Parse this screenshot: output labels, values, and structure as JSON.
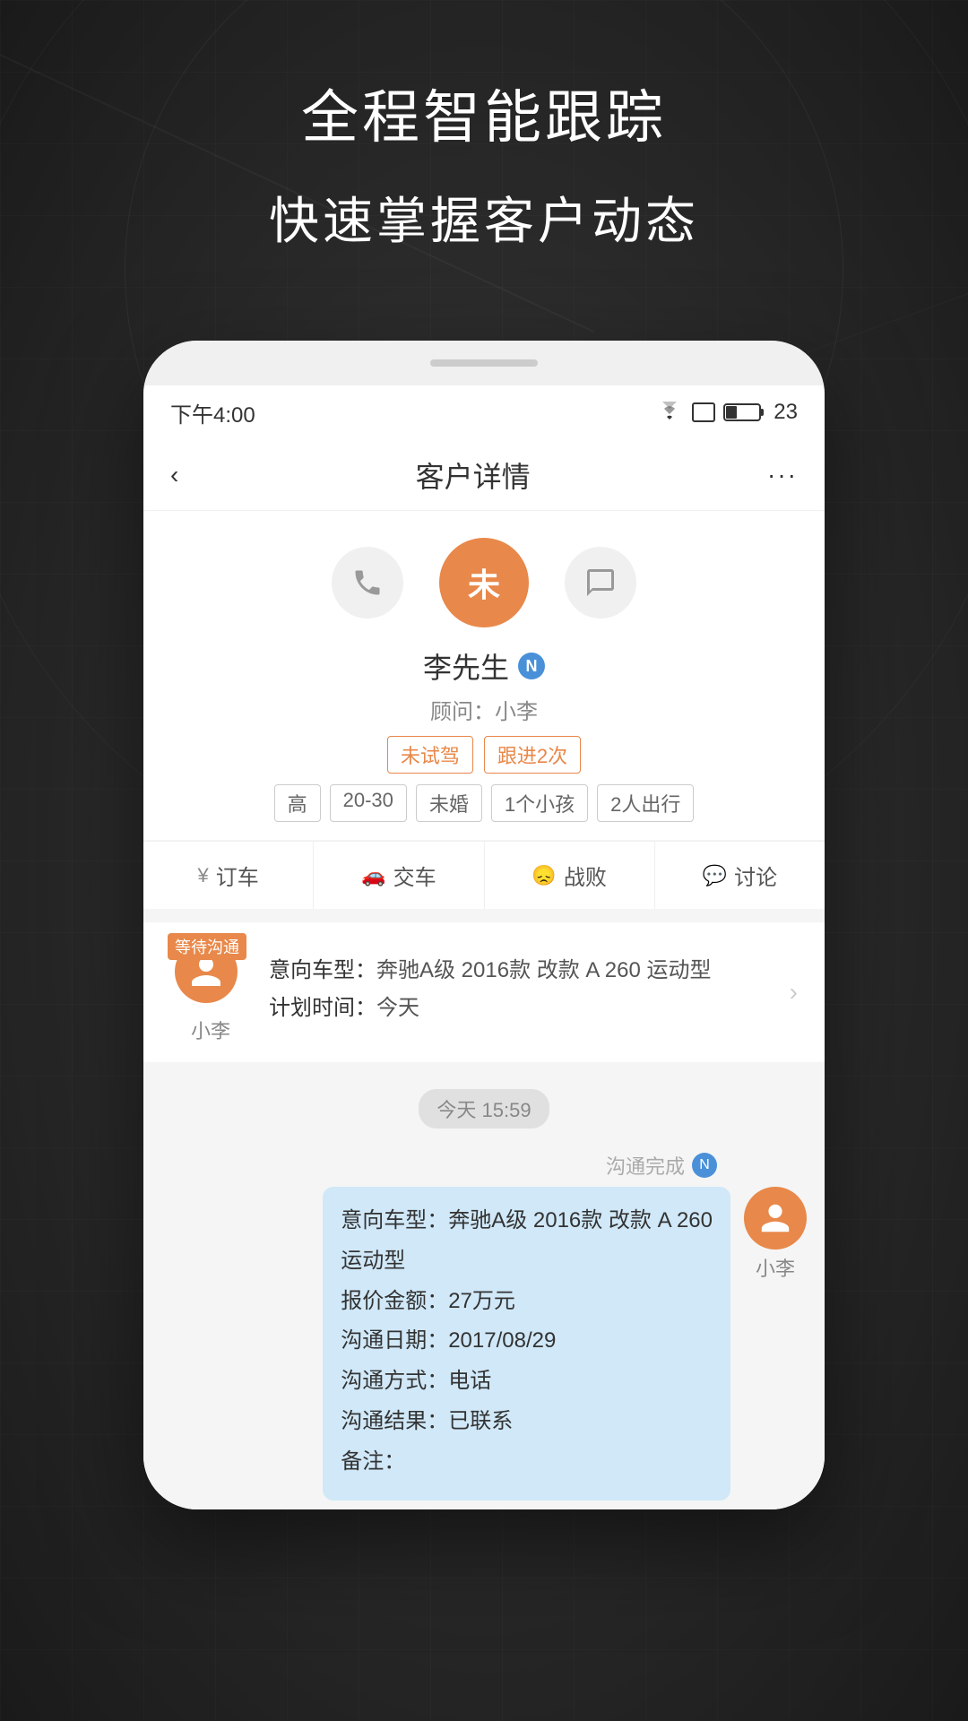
{
  "background": {
    "color": "#2a2a2a"
  },
  "header": {
    "line1": "全程智能跟踪",
    "line2": "快速掌握客户动态"
  },
  "phone": {
    "status_bar": {
      "time": "下午4:00",
      "battery": "23"
    },
    "app_header": {
      "back_label": "‹",
      "title": "客户详情",
      "more_label": "···"
    },
    "customer": {
      "avatar_text": "未",
      "name": "李先生",
      "new_badge": "N",
      "advisor_label": "顾问：小李",
      "tags": [
        "未试驾",
        "跟进2次"
      ],
      "info_tags": [
        "高",
        "20-30",
        "未婚",
        "1个小孩",
        "2人出行"
      ]
    },
    "action_bar": {
      "items": [
        {
          "icon": "yuan-icon",
          "label": "订车"
        },
        {
          "icon": "car-icon",
          "label": "交车"
        },
        {
          "icon": "sad-icon",
          "label": "战败"
        },
        {
          "icon": "chat-icon",
          "label": "讨论"
        }
      ]
    },
    "follow_card": {
      "badge": "等待沟通",
      "avatar_name": "小李",
      "intent_label": "意向车型：",
      "intent_value": "奔驰A级 2016款 改款 A 260 运动型",
      "plan_label": "计划时间：",
      "plan_value": "今天"
    },
    "timeline": {
      "time_label": "今天 15:59",
      "completed_text": "沟通完成",
      "n_badge": "N",
      "sender": "小李",
      "message": {
        "lines": [
          "意向车型：奔驰A级 2016款 改款 A 260",
          "运动型",
          "报价金额：27万元",
          "沟通日期：2017/08/29",
          "沟通方式：电话",
          "沟通结果：已联系",
          "备注："
        ]
      }
    }
  }
}
